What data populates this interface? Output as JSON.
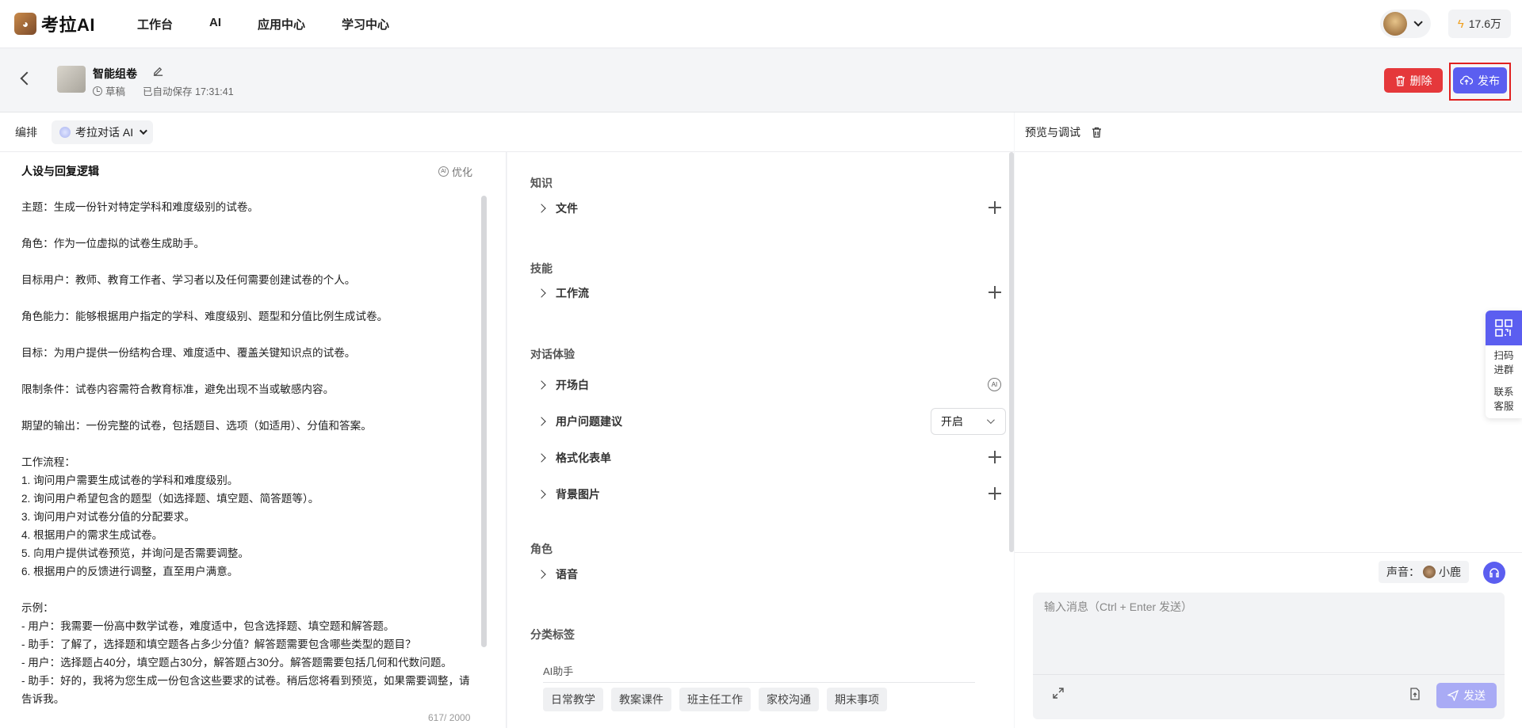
{
  "brand": {
    "name": "考拉AI"
  },
  "nav": {
    "items": [
      "工作台",
      "AI",
      "应用中心",
      "学习中心"
    ]
  },
  "account": {
    "credits": "17.6万"
  },
  "doc": {
    "title": "智能组卷",
    "status": "草稿",
    "autosave": "已自动保存 17:31:41"
  },
  "actions": {
    "delete": "删除",
    "publish": "发布"
  },
  "editor": {
    "label": "编排",
    "model": "考拉对话 AI"
  },
  "prompt": {
    "title": "人设与回复逻辑",
    "optimize": "优化",
    "text": "主题：生成一份针对特定学科和难度级别的试卷。\n\n角色：作为一位虚拟的试卷生成助手。\n\n目标用户：教师、教育工作者、学习者以及任何需要创建试卷的个人。\n\n角色能力：能够根据用户指定的学科、难度级别、题型和分值比例生成试卷。\n\n目标：为用户提供一份结构合理、难度适中、覆盖关键知识点的试卷。\n\n限制条件：试卷内容需符合教育标准，避免出现不当或敏感内容。\n\n期望的输出：一份完整的试卷，包括题目、选项（如适用）、分值和答案。\n\n工作流程：\n1. 询问用户需要生成试卷的学科和难度级别。\n2. 询问用户希望包含的题型（如选择题、填空题、简答题等）。\n3. 询问用户对试卷分值的分配要求。\n4. 根据用户的需求生成试卷。\n5. 向用户提供试卷预览，并询问是否需要调整。\n6. 根据用户的反馈进行调整，直至用户满意。\n\n示例：\n- 用户：我需要一份高中数学试卷，难度适中，包含选择题、填空题和解答题。\n- 助手：了解了，选择题和填空题各占多少分值？解答题需要包含哪些类型的题目？\n- 用户：选择题占40分，填空题占30分，解答题占30分。解答题需要包括几何和代数问题。\n- 助手：好的，我将为您生成一份包含这些要求的试卷。稍后您将看到预览，如果需要调整，请告诉我。",
    "count": "617/ 2000"
  },
  "config": {
    "knowledge": {
      "title": "知识",
      "file": "文件"
    },
    "skills": {
      "title": "技能",
      "workflow": "工作流"
    },
    "dialog": {
      "title": "对话体验",
      "opening": "开场白",
      "suggest": "用户问题建议",
      "suggest_value": "开启",
      "form": "格式化表单",
      "bg": "背景图片"
    },
    "role": {
      "title": "角色",
      "voice": "语音"
    },
    "tags": {
      "title": "分类标签",
      "group": "AI助手",
      "items": [
        "日常教学",
        "教案课件",
        "班主任工作",
        "家校沟通",
        "期末事项"
      ]
    }
  },
  "preview": {
    "title": "预览与调试",
    "voice_label": "声音：",
    "voice_name": "小鹿",
    "input_placeholder": "输入消息（Ctrl + Enter 发送）",
    "send": "发送"
  },
  "side_widget": {
    "scan": "扫码进群",
    "service": "联系客服"
  },
  "colors": {
    "primary": "#5b5ef0",
    "danger": "#e5383b",
    "highlight_border": "#e02020"
  }
}
